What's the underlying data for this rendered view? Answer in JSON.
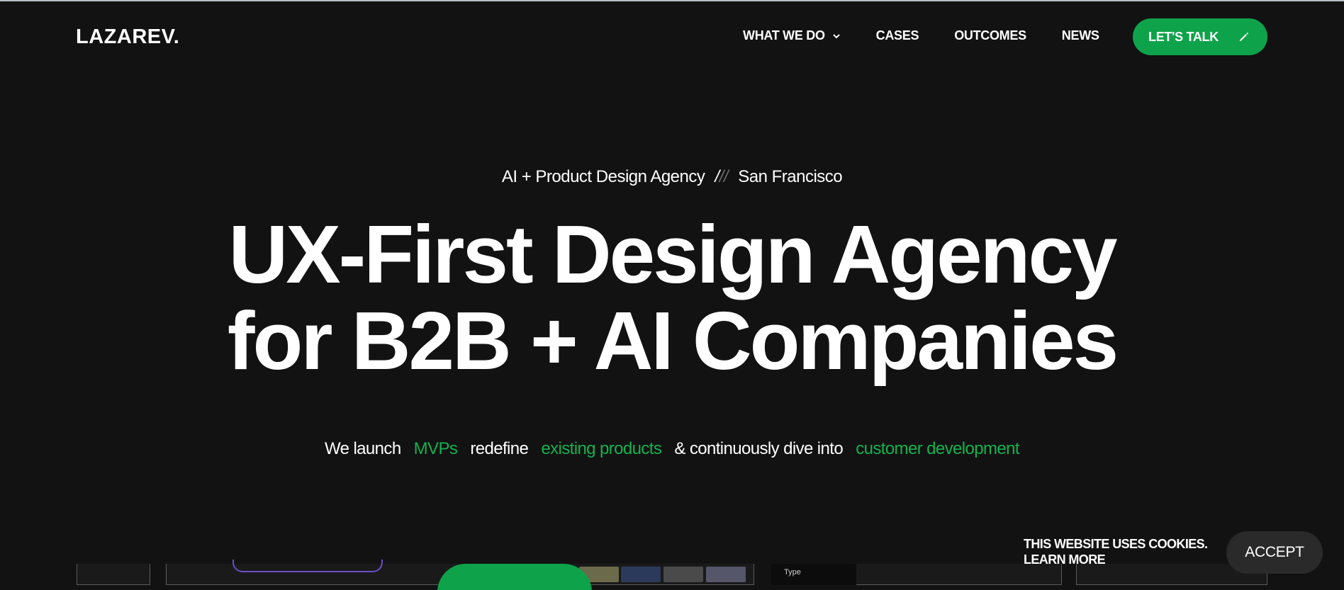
{
  "header": {
    "logo": "LAZAREV.",
    "nav": [
      {
        "label": "WHAT WE DO",
        "has_dropdown": true
      },
      {
        "label": "CASES"
      },
      {
        "label": "OUTCOMES"
      },
      {
        "label": "NEWS"
      }
    ],
    "cta": {
      "label": "LET'S TALK",
      "icon": "pencil-icon"
    }
  },
  "hero": {
    "kicker_left": "AI + Product Design Agency",
    "kicker_sep_a": "/",
    "kicker_sep_b": "//",
    "kicker_right": "San Francisco",
    "headline_line1": "UX-First Design Agency",
    "headline_line2": "for B2B + AI Companies",
    "sub": {
      "p1": "We launch",
      "h1": "MVPs",
      "p2": "redefine",
      "h2": "existing products",
      "p3": "& continuously dive into",
      "h3": "customer development"
    }
  },
  "preview": {
    "type_label": "Type"
  },
  "cookie": {
    "message": "THIS WEBSITE USES COOKIES.",
    "learn_more": "LEARN MORE",
    "accept": "ACCEPT"
  },
  "colors": {
    "background": "#121212",
    "accent_green": "#0ea34a",
    "highlight_green": "#12b24f",
    "accept_bg": "#2a2a2a"
  }
}
